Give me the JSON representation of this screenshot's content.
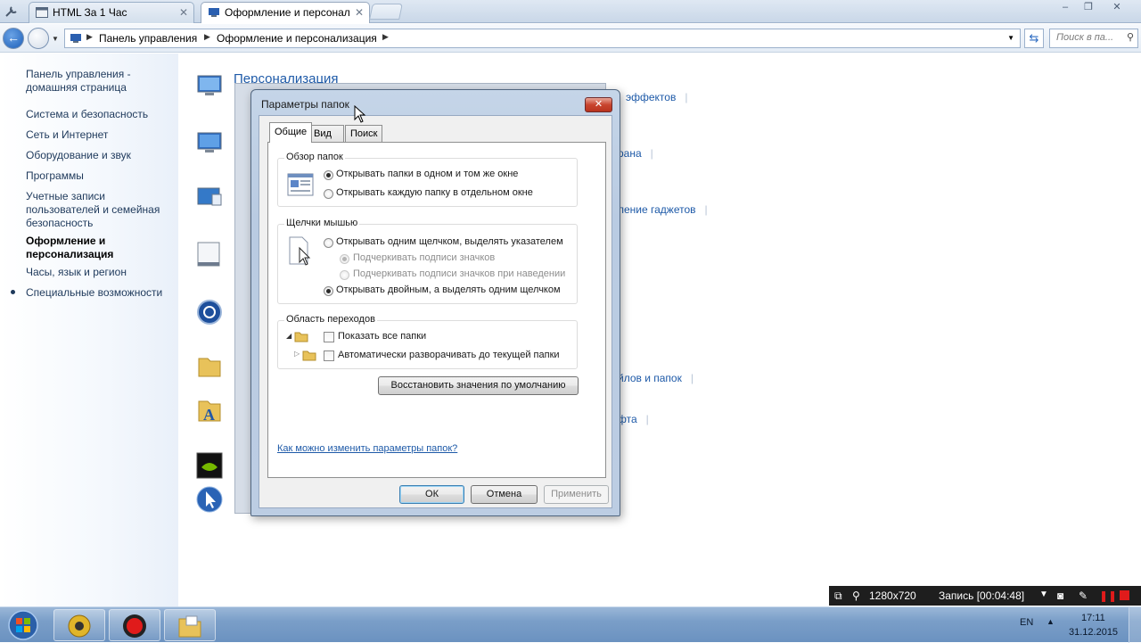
{
  "browser": {
    "tabs": [
      {
        "label": "HTML За 1 Час",
        "active": false
      },
      {
        "label": "Оформление и персонал",
        "active": true
      }
    ],
    "window_controls": {
      "minimize": "–",
      "restore": "❐",
      "close": "✕"
    }
  },
  "address": {
    "crumbs": [
      "Панель управления",
      "Оформление и персонализация"
    ],
    "search_placeholder": "Поиск в па..."
  },
  "sidebar": {
    "items": [
      {
        "label": "Панель управления - домашняя страница",
        "current": false
      },
      {
        "label": "Система и безопасность",
        "current": false
      },
      {
        "label": "Сеть и Интернет",
        "current": false
      },
      {
        "label": "Оборудование и звук",
        "current": false
      },
      {
        "label": "Программы",
        "current": false
      },
      {
        "label": "Учетные записи пользователей и семейная безопасность",
        "current": false
      },
      {
        "label": "Оформление и персонализация",
        "current": true
      },
      {
        "label": "Часы, язык и регион",
        "current": false
      },
      {
        "label": "Специальные возможности",
        "current": false
      }
    ]
  },
  "main": {
    "heading": "Персонализация",
    "links": [
      "эффектов",
      "рана",
      "ление гаджетов",
      "йлов и папок",
      "фта"
    ]
  },
  "dialog": {
    "title": "Параметры папок",
    "close": "✕",
    "tabs": [
      "Общие",
      "Вид",
      "Поиск"
    ],
    "browse": {
      "label": "Обзор папок",
      "options": [
        {
          "label": "Открывать папки в одном и том же окне",
          "selected": true
        },
        {
          "label": "Открывать каждую папку в отдельном окне",
          "selected": false
        }
      ]
    },
    "clicks": {
      "label": "Щелчки мышью",
      "single": "Открывать одним щелчком, выделять указателем",
      "sub_always": "Подчеркивать подписи значков",
      "sub_hover": "Подчеркивать подписи значков при наведении",
      "double": "Открывать двойным, а выделять одним щелчком"
    },
    "nav": {
      "label": "Область переходов",
      "show_all": "Показать все папки",
      "auto_expand": "Автоматически разворачивать до текущей папки"
    },
    "restore_button": "Восстановить значения по умолчанию",
    "help_link": "Как можно изменить параметры папок?",
    "ok": "ОК",
    "cancel": "Отмена",
    "apply": "Применить"
  },
  "recorder": {
    "resolution": "1280x720",
    "status": "Запись [00:04:48]"
  },
  "taskbar": {
    "language": "EN",
    "time": "17:11",
    "date": "31.12.2015"
  },
  "colors": {
    "link": "#1e5aa8",
    "sidebar_text": "#1e395b",
    "record_red": "#e01b1b"
  }
}
